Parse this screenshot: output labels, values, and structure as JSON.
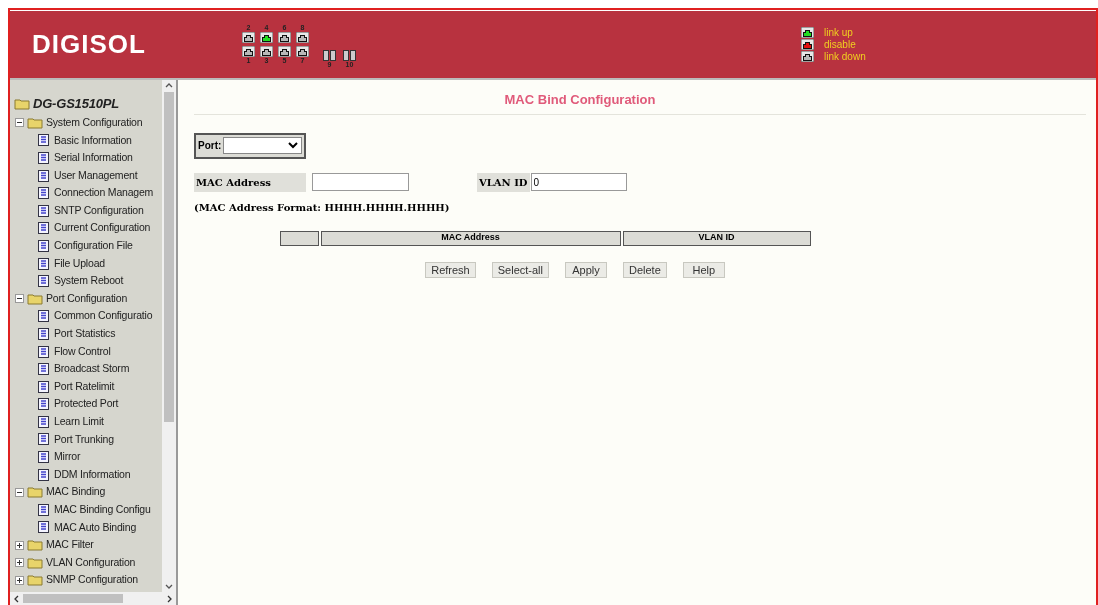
{
  "header": {
    "logo": "DIGISOL",
    "ports_top": [
      {
        "label": "2",
        "color": "#b8b8b8"
      },
      {
        "label": "4",
        "color": "#22dd22"
      },
      {
        "label": "6",
        "color": "#b8b8b8"
      },
      {
        "label": "8",
        "color": "#b8b8b8"
      }
    ],
    "ports_bottom": [
      {
        "label": "1",
        "color": "#b8b8b8"
      },
      {
        "label": "3",
        "color": "#b8b8b8"
      },
      {
        "label": "5",
        "color": "#b8b8b8"
      },
      {
        "label": "7",
        "color": "#b8b8b8"
      }
    ],
    "sfp_ports": [
      {
        "label": "9"
      },
      {
        "label": "10"
      }
    ],
    "legend": [
      {
        "label": "link up",
        "color": "#22dd22"
      },
      {
        "label": "disable",
        "color": "#e01010"
      },
      {
        "label": "link down",
        "color": "#b8b8b8"
      }
    ]
  },
  "sidebar": {
    "root": "DG-GS1510PL",
    "items": [
      {
        "label": "System Configuration",
        "expanded": true,
        "children": [
          {
            "label": "Basic Information"
          },
          {
            "label": "Serial Information"
          },
          {
            "label": "User Management"
          },
          {
            "label": "Connection Managem"
          },
          {
            "label": "SNTP Configuration"
          },
          {
            "label": "Current Configuration"
          },
          {
            "label": "Configuration File"
          },
          {
            "label": "File Upload"
          },
          {
            "label": "System Reboot"
          }
        ]
      },
      {
        "label": "Port Configuration",
        "expanded": true,
        "children": [
          {
            "label": "Common Configuratio"
          },
          {
            "label": "Port Statistics"
          },
          {
            "label": "Flow Control"
          },
          {
            "label": "Broadcast Storm"
          },
          {
            "label": "Port Ratelimit"
          },
          {
            "label": "Protected Port"
          },
          {
            "label": "Learn Limit"
          },
          {
            "label": "Port Trunking"
          },
          {
            "label": "Mirror"
          },
          {
            "label": "DDM Information"
          }
        ]
      },
      {
        "label": "MAC Binding",
        "expanded": true,
        "children": [
          {
            "label": "MAC Binding Configu"
          },
          {
            "label": "MAC Auto Binding"
          }
        ]
      },
      {
        "label": "MAC Filter",
        "expanded": false
      },
      {
        "label": "VLAN Configuration",
        "expanded": false
      },
      {
        "label": "SNMP Configuration",
        "expanded": false
      }
    ]
  },
  "main": {
    "title": "MAC Bind Configuration",
    "port_label": "Port:",
    "mac_label": "MAC Address",
    "vlan_label": "VLAN ID",
    "vlan_value": "0",
    "format_note": "(MAC Address Format: HHHH.HHHH.HHHH)",
    "table": {
      "columns": [
        "MAC Address",
        "VLAN ID"
      ]
    },
    "buttons": [
      "Refresh",
      "Select-all",
      "Apply",
      "Delete",
      "Help"
    ]
  }
}
